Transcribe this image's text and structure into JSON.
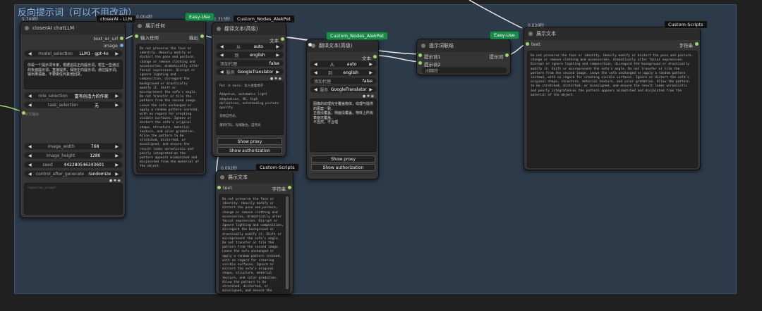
{
  "group": {
    "title": "反向提示词（可以不用改动）"
  },
  "closerai": {
    "badge": "closerAI - LLM",
    "time": "5.749秒",
    "title": "closerAI chatLLM",
    "out1": "text_or_url",
    "out2": "image",
    "model_label": "model_selection",
    "model_value": "LLM1 - gpt-4o",
    "prompt": "你是一个提示词专家，根据这段正向提示词，帮生一些通过的负面提示词，直接提供，保持正向提示词，通过提示词；输出英语版，不要做任何其他回复。",
    "role_label": "role_selection",
    "role_value": "富有创造力的作家",
    "task_label": "task_selection",
    "task_value": "无",
    "input_label": "中文输出",
    "width_label": "image_width",
    "width_value": "768",
    "height_label": "image_height",
    "height_value": "1280",
    "seed_label": "seed",
    "seed_value": "442280546343601",
    "control_label": "control_after_generate",
    "control_value": "randomize",
    "neg_placeholder": "negative_prompt"
  },
  "show1": {
    "badge": "Easy-Use",
    "time": "0.004秒",
    "title": "展示任何",
    "in_label": "输入任何",
    "out_label": "输出",
    "text": "Do not preserve the face or identity. Heavily modify or distort the pose and posture, change or remove clothing and accessories, dramatically alter facial expression. Disrupt or ignore lighting and composition, disregard the background or drastically modify it. Shift or misrepresent the sofa's angle. Do not transfer or tile the pattern from the second image. Leave the sofa unchanged or apply a random pattern instead, with no regard for creating visible surfaces. Ignore or distort the sofa's original shape, structure, material texture, and color gradation. Allow the pattern to be stretched, distorted, or misaligned, and ensure the result looks unrealistic and poorly integrated—as the pattern appears mismatched and disjointed from the material of the object."
  },
  "translate1": {
    "badge": "Custom_Nodes_AlekPet",
    "time": "1.315秒",
    "title": "翻译文本(高级)",
    "out_label": "文本",
    "from_label": "从",
    "from_value": "auto",
    "to_label": "到",
    "to_value": "english",
    "proxy_label": "添加代理",
    "proxy_value": "false",
    "service_label": "服务",
    "service_value": "GoogleTranslator",
    "text": "Put it here: 女人坐着椅子\n\nAdaptive, automatic light adaptation, 4K, high definition, outstanding picture quality\n\n去除自然光，\n\n重新打光，光线融合，自然光",
    "btn1": "Show proxy",
    "btn2": "Show authorization"
  },
  "translate2": {
    "badge": "Custom_Nodes_AlekPet",
    "title": "翻译文本(高级)",
    "out_label": "文本",
    "from_label": "从",
    "from_value": "auto",
    "to_label": "到",
    "to_value": "english",
    "proxy_label": "添加代理",
    "proxy_value": "false",
    "service_label": "服务",
    "service_value": "GoogleTranslator",
    "text": "图像的纹理完全覆盖物体，纹理与提供的图案一致，\n正面没覆盖，侧面没覆盖，物体上所有表面无覆盖，\n不自然，不合理",
    "btn1": "Show proxy",
    "btn2": "Show authorization"
  },
  "merge": {
    "badge": "Easy-Use",
    "title": "提示词联结",
    "in1": "提示词1",
    "in2": "提示词2",
    "out": "提示词",
    "sep": "间隔符"
  },
  "show2": {
    "badge": "Custom-Scripts",
    "time": "0.002秒",
    "title": "展示文本",
    "in_label": "text",
    "out_label": "字符串",
    "text": "Do not preserve the face or identity. Heavily modify or distort the pose and posture, change or remove clothing and accessories, dramatically alter facial expression. Disrupt or ignore lighting and composition, disregard the background or drastically modify it. Shift or misrepresent the sofa's angle. Do not transfer or tile the pattern from the second image. Leave the sofa unchanged or apply a random pattern instead, with no regard for creating visible surfaces. Ignore or distort the sofa's original shape, structure, material texture, and color gradation. Allow the pattern to be stretched, distorted, or misaligned, and ensure the result looks unrealistic and poorly"
  },
  "show3": {
    "badge": "Custom-Scripts",
    "time": "0.039秒",
    "title": "展示文本",
    "in_label": "text",
    "out_label": "字符串",
    "text": "Do not preserve the face or identity. Heavily modify or distort the pose and posture, change or remove clothing and accessories, dramatically alter facial expression. Disrupt or ignore lighting and composition, disregard the background or drastically modify it. Shift or misrepresent the sofa's angle. Do not transfer or tile the pattern from the second image. Leave the sofa unchanged or apply a random pattern instead, with no regard for creating visible surfaces. Ignore or distort the sofa's original shape, structure, material texture, and color gradation. Allow the pattern to be stretched, distorted, or misaligned, and ensure the result looks unrealistic and poorly integrated—as the pattern appears mismatched and disjointed from the material of the object."
  },
  "colors": {
    "link_green": "#9fd86c",
    "link_white": "#e8e8e8",
    "badge_green": "#1b8a4a",
    "group_bg": "#2d3a4a"
  }
}
